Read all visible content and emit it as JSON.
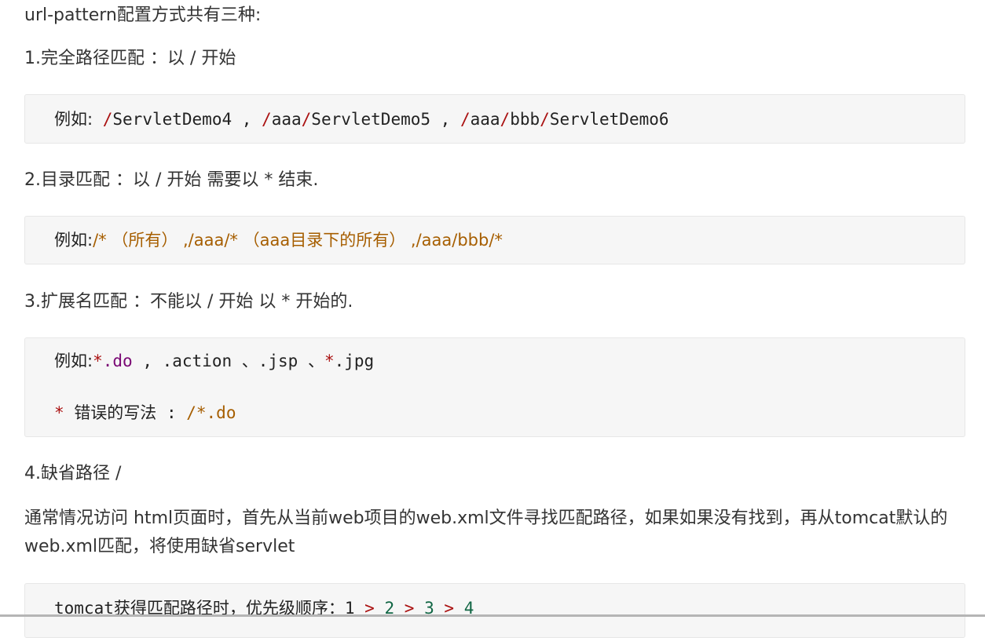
{
  "intro": "url-pattern配置方式共有三种:",
  "sections": [
    {
      "heading": "1.完全路径匹配  ：以 / 开始",
      "code": {
        "label": "例如:",
        "slash1": "/",
        "p1": "ServletDemo4",
        "sep1": " , ",
        "slash2": "/",
        "p2a": "aaa",
        "slash3": "/",
        "p2b": "ServletDemo5",
        "sep2": " , ",
        "slash4": "/",
        "p3a": "aaa",
        "slash5": "/",
        "p3b": "bbb",
        "slash6": "/",
        "p3c": "ServletDemo6"
      }
    },
    {
      "heading": "2.目录匹配  ：以 / 开始 需要以 * 结束.",
      "code": {
        "label": "例如:",
        "text": "/*  （所有） ,/aaa/* （aaa目录下的所有） ,/aaa/bbb/*"
      }
    },
    {
      "heading": "3.扩展名匹配  ：不能以 / 开始 以 * 开始的.",
      "code": {
        "label": "例如:",
        "star1": "*",
        "dot_do": ".do",
        "rest": " , .action 、.jsp 、",
        "star2": "*",
        "jpg": ".jpg",
        "star3": "*",
        "wrong_label": "错误的写法",
        "colon": "  :  ",
        "wrong_value": "/*.do"
      }
    },
    {
      "heading": "4.缺省路径 /",
      "paragraph": " 通常情况访问 html页面时，首先从当前web项目的web.xml文件寻找匹配路径，如果如果没有找到，再从tomcat默认的web.xml匹配，将使用缺省servlet",
      "code": {
        "prefix": "tomcat",
        "label": "获得匹配路径时，优先级顺序：",
        "n1": "1",
        "gt1": ">",
        "n2": "2",
        "gt2": ">",
        "n3": "3",
        "gt3": ">",
        "n4": "4"
      }
    }
  ]
}
